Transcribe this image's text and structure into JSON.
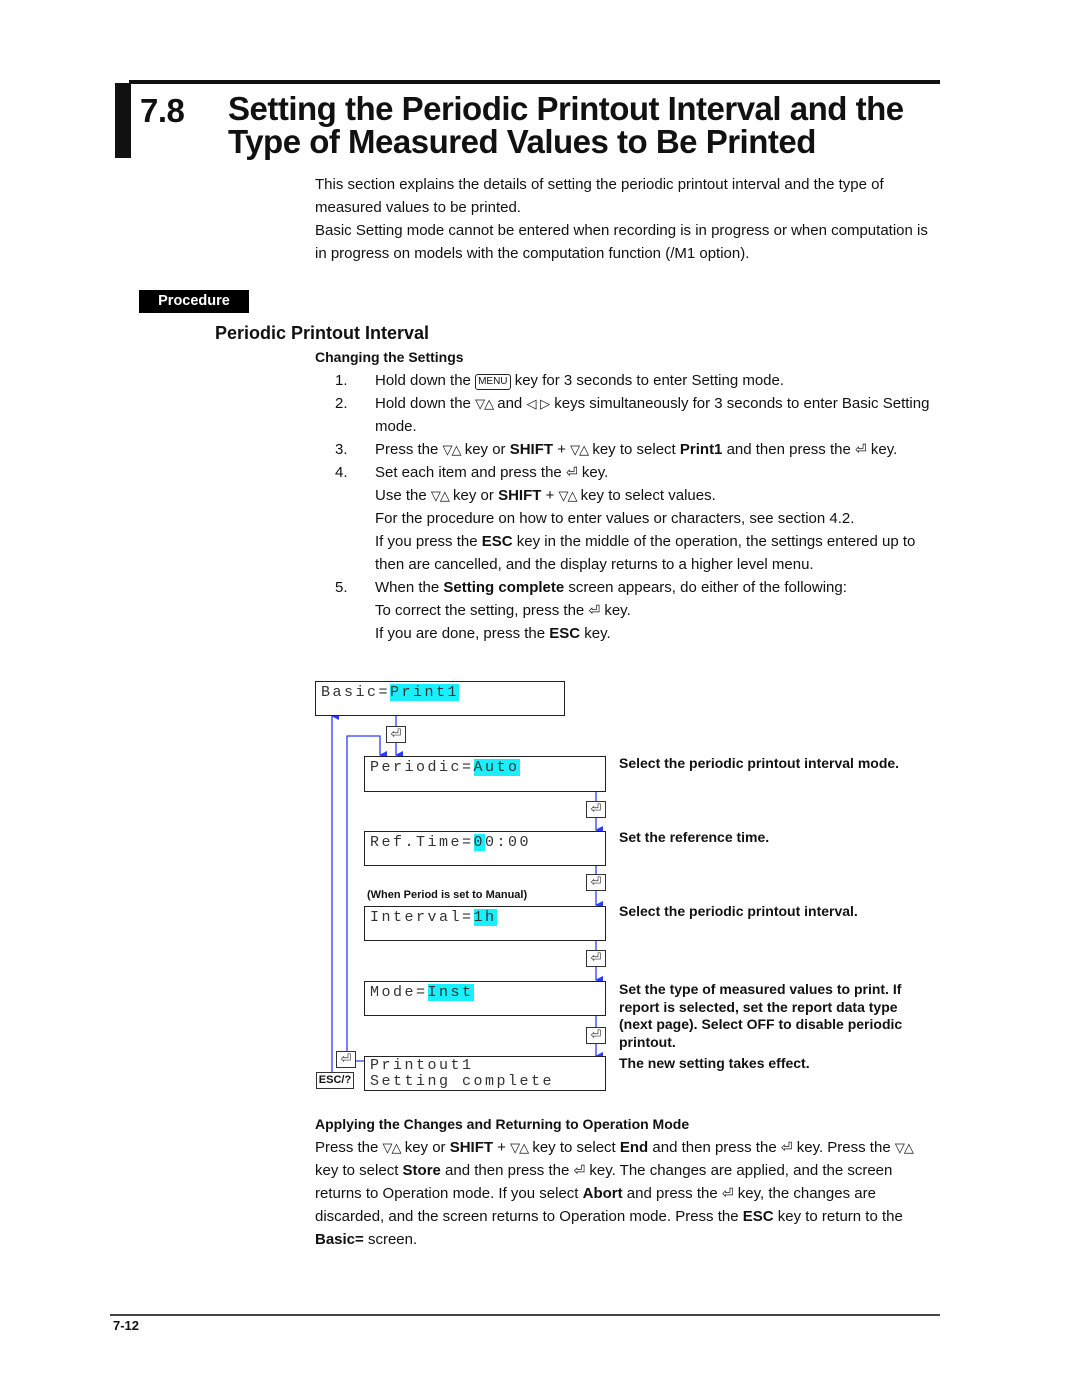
{
  "header": {
    "section_number": "7.8",
    "title_line1": "Setting the Periodic Printout Interval and the",
    "title_line2": "Type of Measured Values to Be Printed"
  },
  "intro": {
    "p1": "This section explains the details of setting the periodic printout interval and the type of measured values to be printed.",
    "p2": "Basic Setting mode cannot be entered when recording is in progress or when computation is in progress on models with the computation function (/M1 option)."
  },
  "procedure_badge": "Procedure",
  "section_heading": "Periodic Printout Interval",
  "subheading_changing": "Changing the Settings",
  "keys": {
    "menu": "MENU",
    "updown": "▽△",
    "leftright": "◁ ▷",
    "enter": "⏎",
    "esc": "ESC/?"
  },
  "steps": [
    {
      "num": "1.",
      "a": "Hold down the ",
      "b": " key for 3 seconds to enter Setting mode."
    },
    {
      "num": "2.",
      "a": "Hold down the ",
      "b": " and ",
      "c": " keys simultaneously for 3 seconds to enter Basic Setting mode."
    },
    {
      "num": "3.",
      "a": "Press the ",
      "b": " key or ",
      "shift": "SHIFT",
      "c": " + ",
      "d": " key to select ",
      "bold": "Print1",
      "e": " and then press the ",
      "f": " key."
    },
    {
      "num": "4.",
      "a": "Set each item and press the ",
      "b": " key.",
      "l2a": "Use the ",
      "l2b": " key or ",
      "l2shift": "SHIFT",
      "l2c": " + ",
      "l2d": " key to select values.",
      "l3": "For the procedure on how to enter values or characters, see section 4.2.",
      "l4a": "If you press the ",
      "l4esc": "ESC",
      "l4b": " key in the middle of the operation, the settings entered up to then are cancelled, and the display returns to a higher level menu."
    },
    {
      "num": "5.",
      "a": "When the ",
      "bold": "Setting complete",
      "b": " screen appears, do either of the following:",
      "l2a": "To correct the setting, press the ",
      "l2b": " key.",
      "l3a": "If you are done, press the ",
      "l3esc": "ESC",
      "l3b": " key."
    }
  ],
  "diagram": {
    "screens": [
      {
        "label": "Basic=",
        "value": "Print1"
      },
      {
        "label": "Periodic=",
        "value": "Auto"
      },
      {
        "label": "Ref.Time=",
        "value": "0",
        "rest": "0:00"
      },
      {
        "label": "Interval=",
        "value": "1h"
      },
      {
        "label": "Mode=",
        "value": "Inst"
      },
      {
        "line1": "Printout1",
        "line2": "Setting complete"
      }
    ],
    "note": "(When Period is set to Manual)",
    "descriptions": [
      "Select the periodic printout interval mode.",
      "Set the reference time.",
      "Select the periodic printout interval.",
      "Set the type of measured values to print. If report is selected, set the report data type (next page).  Select OFF to disable periodic printout.",
      "The new setting takes effect."
    ],
    "highlight_color": "#19f0ff",
    "line_color": "#2a3cff"
  },
  "apply": {
    "heading": "Applying the Changes and Returning to Operation Mode",
    "t1": "Press the ",
    "t2": " key or ",
    "shift": "SHIFT",
    "t3": " + ",
    "t4": " key to select ",
    "end": "End",
    "t5": " and then press the ",
    "t6": " key.  Press the ",
    "t7": " key to select ",
    "store": "Store",
    "t8": " and then press the ",
    "t9": " key.  The changes are applied, and the screen returns to Operation mode.  If you select ",
    "abort": "Abort",
    "t10": " and press the ",
    "t11": " key, the changes are discarded, and the screen returns to Operation mode.  Press the ",
    "esc": "ESC",
    "t12": " key to return to the ",
    "basic": "Basic=",
    "t13": " screen."
  },
  "footer": {
    "page_number": "7-12"
  }
}
